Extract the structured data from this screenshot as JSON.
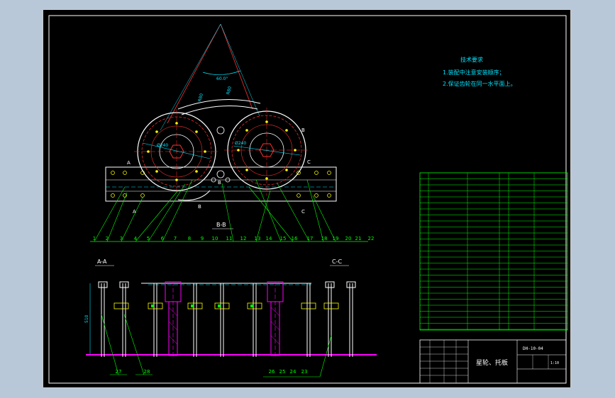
{
  "notes": {
    "heading": "技术要求",
    "line1": "1.装配中注意安装顺序；",
    "line2": "2.保证齿轮在同一水平面上。"
  },
  "section_labels": {
    "bb": "B-B",
    "aa": "A-A",
    "cc": "C-C"
  },
  "view_marks": {
    "a_top": "A",
    "a_bot": "A",
    "b_1": "B",
    "b_2": "B",
    "b_3": "B",
    "c_top": "C",
    "c_bot": "C"
  },
  "dimensions": {
    "height_dim": "510",
    "angle_dim": "60.0°",
    "radial_1": "R80",
    "radial_2": "R80",
    "dia_left": "Ø240",
    "dia_right": "Ø240"
  },
  "balloons_top": [
    "1",
    "2",
    "3",
    "4",
    "5",
    "6",
    "7",
    "8",
    "9",
    "10",
    "11",
    "12",
    "13",
    "14",
    "15",
    "16",
    "17",
    "18",
    "19",
    "20",
    "21",
    "22"
  ],
  "balloons_bottom": [
    "27",
    "28",
    "26",
    "25",
    "24",
    "23"
  ],
  "title_block": {
    "drawing_no": "DH-10-04",
    "part_name": "星轮、托板",
    "scale": "1:10"
  },
  "colors": {
    "background": "#000000",
    "outline": "#ffffff",
    "dimension": "#00e5ff",
    "center": "#ff3030",
    "hatch": "#ff00ff",
    "leader": "#00ff00",
    "fill": "#ffff00"
  }
}
